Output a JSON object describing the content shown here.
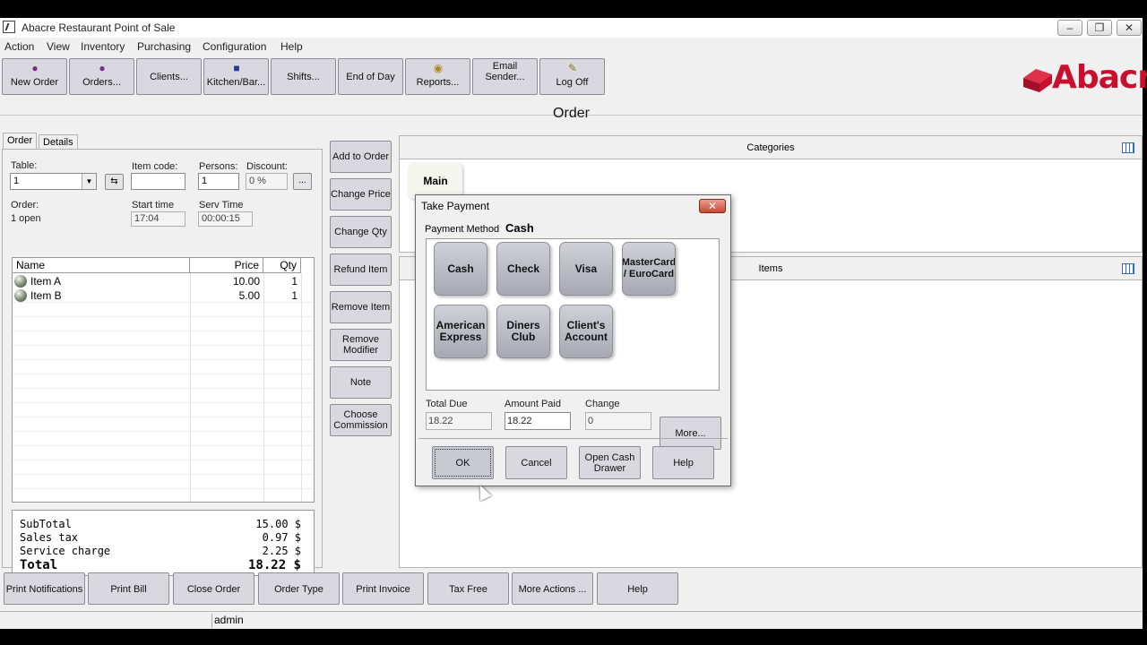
{
  "window": {
    "title": "Abacre Restaurant Point of Sale"
  },
  "menu": [
    "Action",
    "View",
    "Inventory",
    "Purchasing",
    "Configuration",
    "Help"
  ],
  "toolbar": [
    {
      "label": "New Order",
      "icon": "new-order-icon"
    },
    {
      "label": "Orders...",
      "icon": "orders-icon"
    },
    {
      "label": "Clients...",
      "icon": ""
    },
    {
      "label": "Kitchen/Bar...",
      "icon": "kitchen-icon"
    },
    {
      "label": "Shifts...",
      "icon": ""
    },
    {
      "label": "End of Day",
      "icon": ""
    },
    {
      "label": "Reports...",
      "icon": "reports-icon"
    },
    {
      "label": "Email Sender...",
      "icon": ""
    },
    {
      "label": "Log Off",
      "icon": "log-off-icon"
    }
  ],
  "logo": {
    "text": "Abacre",
    "color": "#c8102e"
  },
  "page_title": "Order",
  "tabs": [
    "Order",
    "Details"
  ],
  "order_form": {
    "table_label": "Table:",
    "table_value": "1",
    "item_code_label": "Item code:",
    "item_code_value": "",
    "persons_label": "Persons:",
    "persons_value": "1",
    "discount_label": "Discount:",
    "discount_value": "0 %",
    "discount_btn": "...",
    "order_label": "Order:",
    "order_value": "1 open",
    "start_time_label": "Start time",
    "start_time_value": "17:04",
    "serv_time_label": "Serv Time",
    "serv_time_value": "00:00:15"
  },
  "grid": {
    "columns": [
      "Name",
      "Price",
      "Qty"
    ],
    "rows": [
      {
        "name": "Item A",
        "price": "10.00",
        "qty": "1"
      },
      {
        "name": "Item B",
        "price": "5.00",
        "qty": "1"
      }
    ]
  },
  "totals": {
    "subtotal_label": "SubTotal",
    "subtotal_value": "15.00 $",
    "tax_label": "Sales tax",
    "tax_value": "0.97 $",
    "service_label": "Service charge",
    "service_value": "2.25 $",
    "total_label": "Total",
    "total_value": "18.22 $"
  },
  "side_buttons": [
    "Add to Order",
    "Change Price",
    "Change Qty",
    "Refund Item",
    "Remove Item",
    "Remove Modifier",
    "Note",
    "Choose Commission"
  ],
  "categories": {
    "header": "Categories",
    "items": [
      "Main"
    ]
  },
  "items_panel": {
    "header": "Items"
  },
  "bottom_buttons": [
    "Print Notifications",
    "Print Bill",
    "Close Order",
    "Order Type",
    "Print Invoice",
    "Tax Free",
    "More Actions ...",
    "Help"
  ],
  "status": {
    "user": "admin"
  },
  "dialog": {
    "title": "Take Payment",
    "payment_method_label": "Payment Method",
    "payment_method_value": "Cash",
    "methods": [
      "Cash",
      "Check",
      "Visa",
      "MasterCard / EuroCard",
      "American Express",
      "Diners Club",
      "Client's Account"
    ],
    "total_due_label": "Total Due",
    "total_due_value": "18.22",
    "amount_paid_label": "Amount Paid",
    "amount_paid_value": "18.22",
    "change_label": "Change",
    "change_value": "0",
    "more_btn": "More...",
    "ok_btn": "OK",
    "cancel_btn": "Cancel",
    "open_drawer_btn": "Open Cash Drawer",
    "help_btn": "Help"
  }
}
